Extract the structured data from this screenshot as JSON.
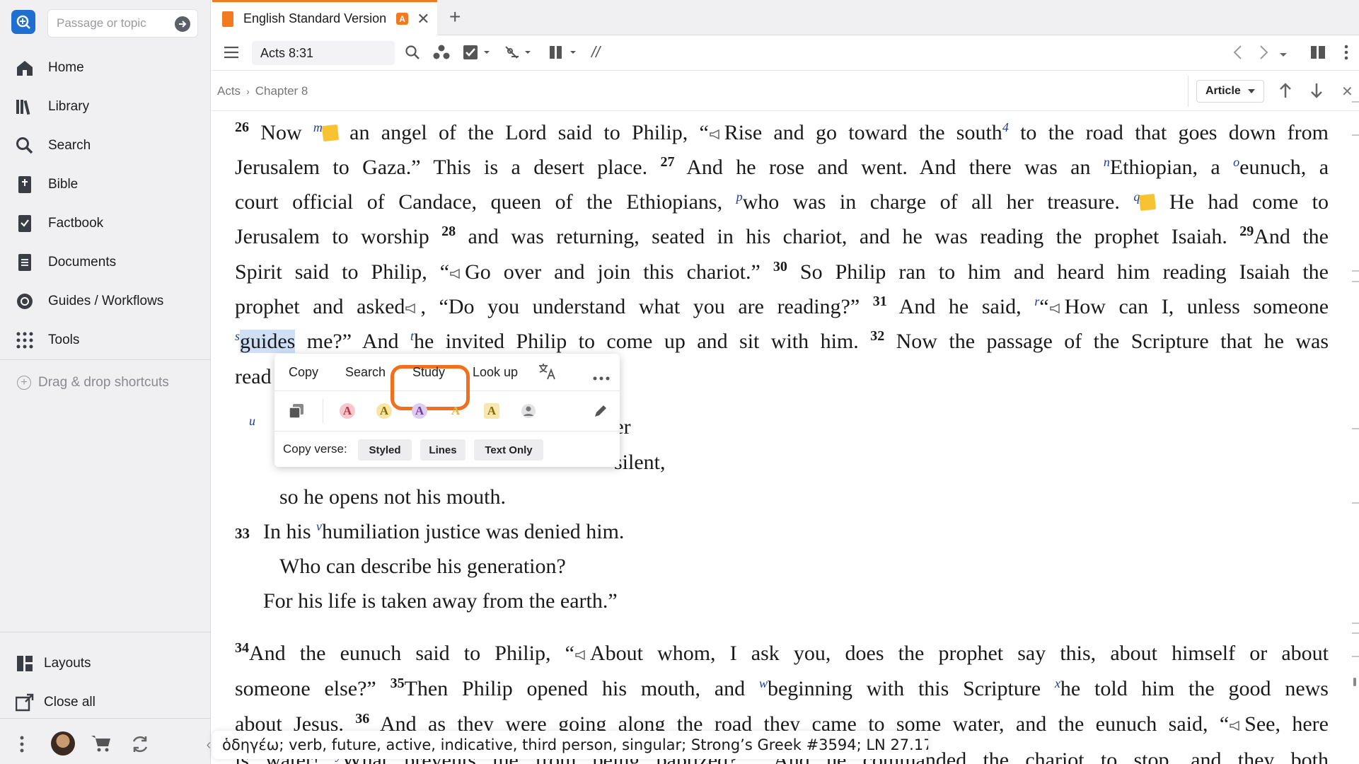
{
  "sidebar": {
    "search_placeholder": "Passage or topic",
    "items": [
      {
        "label": "Home",
        "icon": "home-icon"
      },
      {
        "label": "Library",
        "icon": "library-icon"
      },
      {
        "label": "Search",
        "icon": "search-icon"
      },
      {
        "label": "Bible",
        "icon": "bible-icon"
      },
      {
        "label": "Factbook",
        "icon": "factbook-icon"
      },
      {
        "label": "Documents",
        "icon": "documents-icon"
      },
      {
        "label": "Guides / Workflows",
        "icon": "guides-icon"
      },
      {
        "label": "Tools",
        "icon": "tools-icon"
      }
    ],
    "drag_drop": "Drag & drop shortcuts",
    "layouts": "Layouts",
    "close_all": "Close all"
  },
  "tab": {
    "title": "English Standard Version",
    "badge": "A"
  },
  "toolbar": {
    "reference": "Acts 8:31",
    "parallel_label": "//"
  },
  "breadcrumb": {
    "book": "Acts",
    "chapter": "Chapter 8"
  },
  "article_button": "Article",
  "popup": {
    "actions": [
      "Copy",
      "Search",
      "Study",
      "Look up"
    ],
    "copy_verse_label": "Copy verse:",
    "copy_options": [
      "Styled",
      "Lines",
      "Text Only"
    ],
    "highlight_letter": "A",
    "highlight_colors": [
      "#e05a5a",
      "#e3b82a",
      "#8c5bc4",
      "#e8c23a",
      "#e0b52a"
    ]
  },
  "status_text": "ὁδηγέω; verb, future, active, indicative, third person, singular; Strong’s Greek #3594; LN 27.17",
  "text": {
    "v26": "26",
    "l1_a": "Now ",
    "fn_m": "m",
    "l1_b": " an angel of the Lord said to Philip, “",
    "l1_c": "Rise and go toward the south",
    "fn_4": "4",
    "l1_d": " to the road that goes down from",
    "l2_a": "Jerusalem to Gaza.” This is a desert place. ",
    "v27": "27",
    "l2_b": " And he rose and went. And there was an ",
    "fn_n": "n",
    "l2_c": "Ethiopian, a ",
    "fn_o": "o",
    "l2_d": "eunuch, a",
    "l3_a": "court official of Candace, queen of the Ethiopians, ",
    "fn_p": "p",
    "l3_b": "who was in charge of all her treasure. ",
    "fn_q": "q",
    "l3_c": " He had come to",
    "l4_a": "Jerusalem to worship ",
    "v28": "28",
    "l4_b": " and was returning, seated in his chariot, and he was reading the prophet Isaiah. ",
    "v29": "29",
    "l4_c": "And the",
    "l5_a": "Spirit said to Philip, “",
    "l5_b": "Go over and join this chariot.” ",
    "v30": "30",
    "l5_c": " So Philip ran to him and heard him reading Isaiah the",
    "l6_a": "prophet and asked",
    "l6_b": ", “Do you understand what you are reading?” ",
    "v31": "31",
    "l6_c": " And he said, ",
    "fn_r": "r",
    "l6_d": "“",
    "l6_e": "How can I, unless someone",
    "fn_s": "s",
    "l7_sel": "guides",
    "l7_a": " me?” And ",
    "fn_t": "t",
    "l7_b": "he invited Philip to come up and sit with him. ",
    "v32": "32",
    "l7_c": " Now the passage of the Scripture that he was",
    "l8_a": "read",
    "fn_u": "u",
    "q1_end": "nter",
    "q2_end": "silent,",
    "q3": "so he opens not his mouth.",
    "v33": "33",
    "fn_v": "v",
    "q4_a": "In his ",
    "q4_b": "humiliation justice was denied him.",
    "q5": "Who can describe his generation?",
    "q6": "For his life is taken away from the earth.”",
    "v34": "34",
    "p2_a": "And the eunuch said to Philip, “",
    "p2_b": "About whom, I ask you, does the prophet say this, about himself or about",
    "p3_a": "someone else?” ",
    "v35": "35",
    "p3_b": "Then Philip opened his mouth, and ",
    "fn_w": "w",
    "p3_c": "beginning with this Scripture ",
    "fn_x": "x",
    "p3_d": "he told him the good news",
    "p4_a": "about Jesus. ",
    "v36": "36",
    "p4_b": " And as they were going along the road they came to some water, and the eunuch said, “",
    "p4_c": "See, here",
    "p5_a": "is water! ",
    "fn_y": "y",
    "p5_b": "What prevents me from being baptized?",
    "fn_5": "5",
    "v38": "38",
    "p5_c": " And he commanded the chariot to stop, and they both"
  }
}
